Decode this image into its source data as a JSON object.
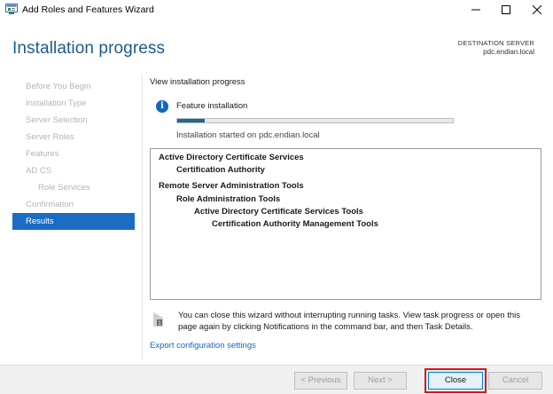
{
  "window": {
    "title": "Add Roles and Features Wizard",
    "controls": {
      "minimize": "minimize-icon",
      "maximize": "maximize-icon",
      "close": "close-icon"
    }
  },
  "header": {
    "page_title": "Installation progress",
    "destination_label": "DESTINATION SERVER",
    "destination_server": "pdc.endian.local"
  },
  "nav": {
    "items": [
      {
        "label": "Before You Begin",
        "state": "disabled"
      },
      {
        "label": "Installation Type",
        "state": "disabled"
      },
      {
        "label": "Server Selection",
        "state": "disabled"
      },
      {
        "label": "Server Roles",
        "state": "disabled"
      },
      {
        "label": "Features",
        "state": "disabled"
      },
      {
        "label": "AD CS",
        "state": "disabled"
      },
      {
        "label": "Role Services",
        "state": "disabled"
      },
      {
        "label": "Confirmation",
        "state": "disabled"
      },
      {
        "label": "Results",
        "state": "active"
      }
    ]
  },
  "main": {
    "view_label": "View installation progress",
    "feature_label": "Feature installation",
    "progress_fraction": 0.1,
    "started_label": "Installation started on pdc.endian.local",
    "results": [
      "Active Directory Certificate Services",
      "Certification Authority",
      "Remote Server Administration Tools",
      "Role Administration Tools",
      "Active Directory Certificate Services Tools",
      "Certification Authority Management Tools"
    ],
    "note": "You can close this wizard without interrupting running tasks. View task progress or open this page again by clicking Notifications in the command bar, and then Task Details.",
    "export_link": "Export configuration settings"
  },
  "footer": {
    "previous": "< Previous",
    "next": "Next >",
    "close": "Close",
    "cancel": "Cancel"
  },
  "colors": {
    "accent": "#1b6cc5",
    "title": "#1f5a8f",
    "progress": "#1a6b8f",
    "highlight": "#d11a1a"
  }
}
